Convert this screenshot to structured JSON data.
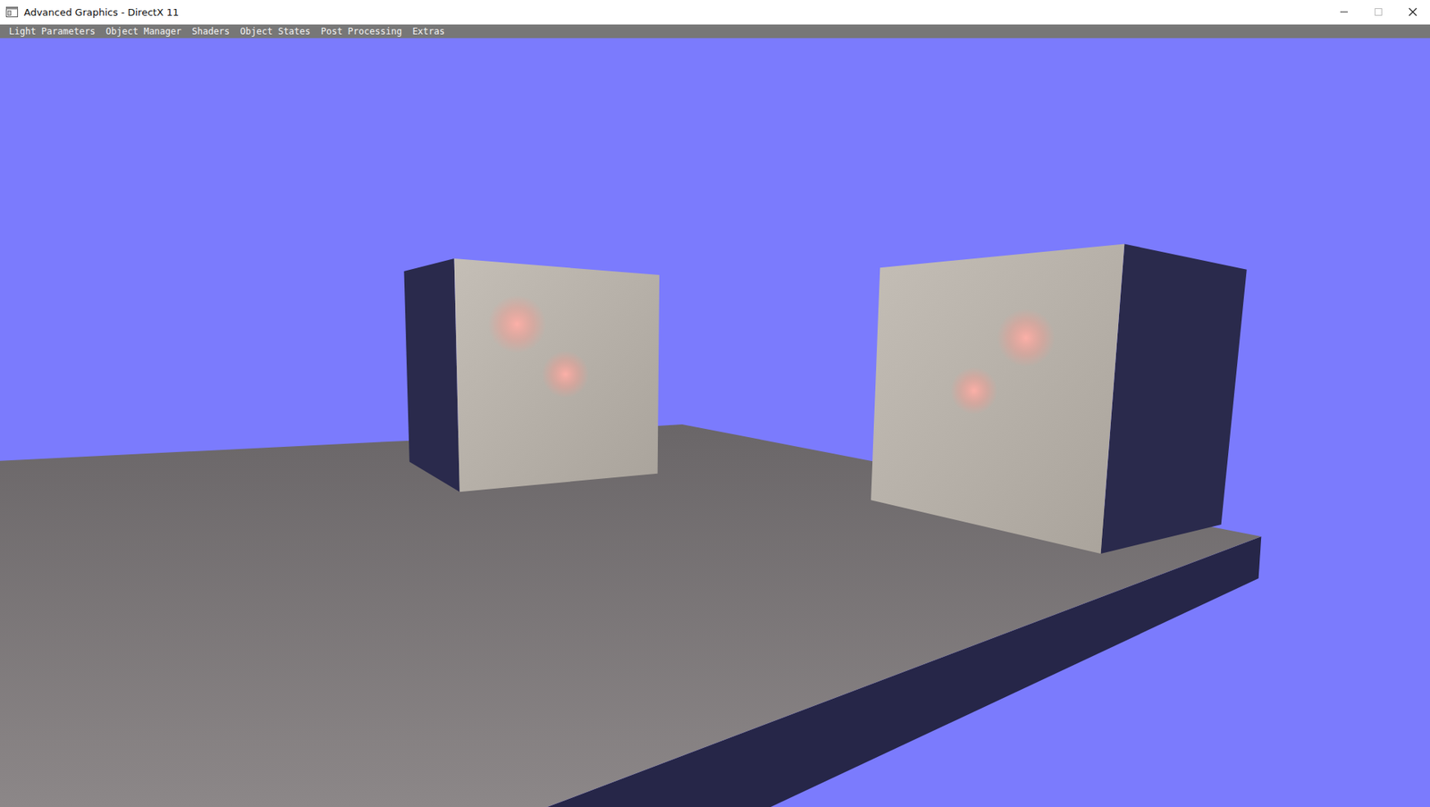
{
  "window": {
    "title": "Advanced Graphics - DirectX 11"
  },
  "menu": [
    "Light Parameters",
    "Object Manager",
    "Shaders",
    "Object States",
    "Post Processing",
    "Extras"
  ]
}
